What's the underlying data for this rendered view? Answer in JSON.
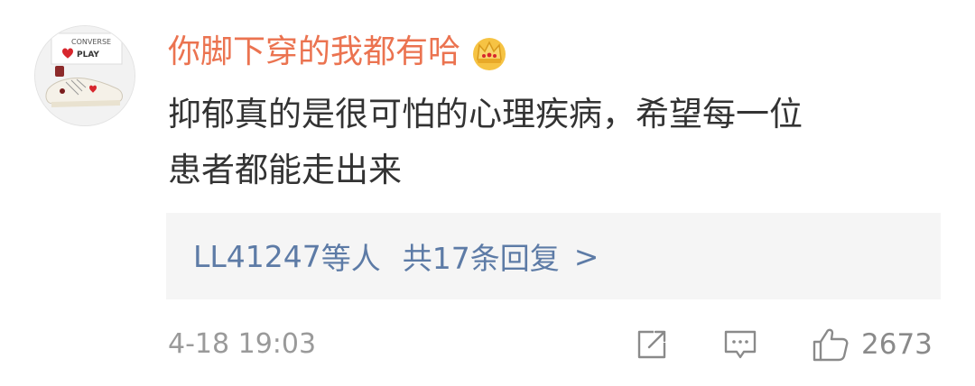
{
  "comment": {
    "username": "你脚下穿的我都有哈",
    "badge_icon": "crown-icon",
    "text_lines": "抑郁真的是很可怕的心理疾病，希望每一位\n患者都能走出来",
    "avatar": {
      "icon": "sneaker-photo",
      "brand_text": "CONVERSE",
      "play_text": "PLAY"
    }
  },
  "replies": {
    "users_text": "LL41247",
    "suffix": "等人",
    "count_text": "共17条回复",
    "chevron": ">"
  },
  "footer": {
    "timestamp": "4-18 19:03",
    "share_icon": "share-icon",
    "comment_icon": "comment-icon",
    "like_icon": "thumbs-up-icon",
    "like_count": "2673"
  },
  "colors": {
    "username": "#eb7350",
    "link": "#5d7ba6",
    "text": "#333333",
    "muted": "#9a9a9a",
    "reply_bg": "#f5f5f5"
  }
}
